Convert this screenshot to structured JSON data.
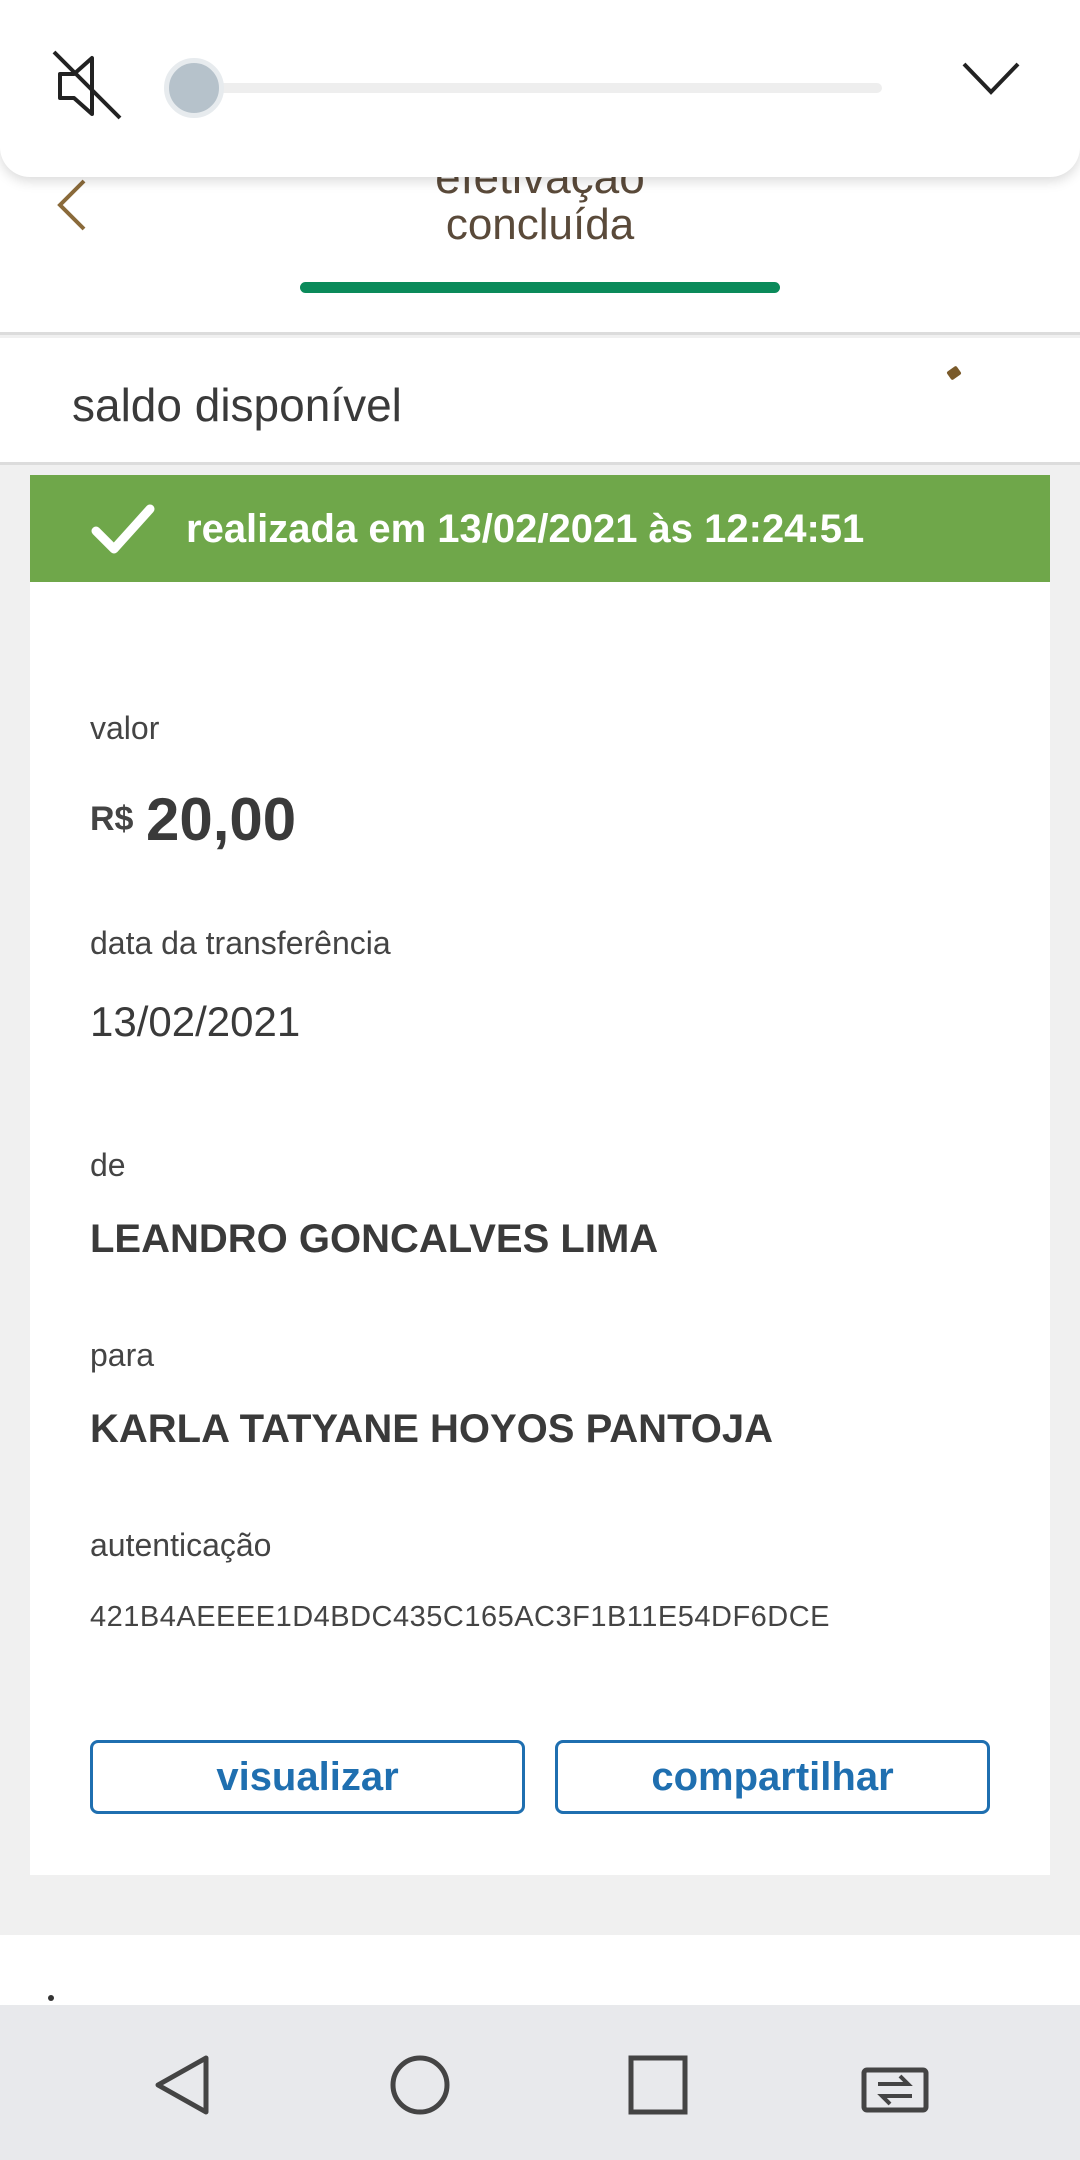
{
  "header": {
    "title_partial": "efetivação",
    "subtitle": "concluída",
    "back_icon": "chevron-left-icon"
  },
  "balance": {
    "label": "saldo disponível"
  },
  "receipt": {
    "status_text": "realizada em 13/02/2021 às 12:24:51",
    "status_color": "#6fa74a",
    "value_label": "valor",
    "currency": "R$",
    "amount": "20,00",
    "date_label": "data da transferência",
    "date_value": "13/02/2021",
    "from_label": "de",
    "from_value": "LEANDRO GONCALVES LIMA",
    "to_label": "para",
    "to_value": "KARLA TATYANE HOYOS PANTOJA",
    "auth_label": "autenticação",
    "auth_value": "421B4AEEEE1D4BDC435C165AC3F1B11E54DF6DCE",
    "view_button": "visualizar",
    "share_button": "compartilhar"
  },
  "volume": {
    "muted": true,
    "level": 0,
    "icon": "volume-mute-icon",
    "collapse_icon": "chevron-down-icon"
  },
  "nav": {
    "back_icon": "nav-back-icon",
    "home_icon": "nav-home-icon",
    "recents_icon": "nav-recents-icon",
    "switch_icon": "nav-switch-apps-icon"
  },
  "colors": {
    "accent_green": "#0a8a5a",
    "button_blue": "#1f6fb0"
  }
}
